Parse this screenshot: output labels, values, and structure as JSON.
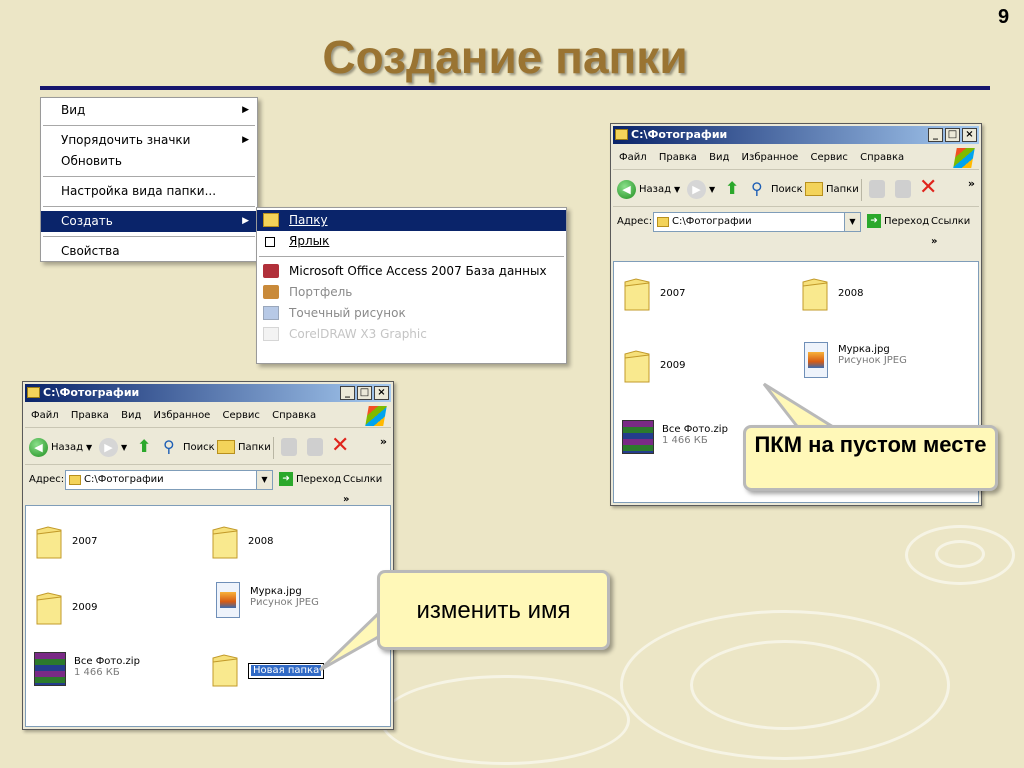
{
  "slide": {
    "number": "9",
    "title": "Создание папки"
  },
  "context_menu": {
    "items": [
      {
        "label": "Вид",
        "arrow": "▶"
      },
      {
        "label": "Упорядочить значки",
        "arrow": "▶"
      },
      {
        "label": "Обновить"
      },
      {
        "label": "Настройка вида папки..."
      },
      {
        "label": "Создать",
        "arrow": "▶",
        "selected": true
      },
      {
        "label": "Свойства"
      }
    ]
  },
  "submenu": {
    "items": [
      {
        "label": "Папку",
        "icon": "folder-icon",
        "selected": true
      },
      {
        "label": "Ярлык",
        "icon": "shortcut-icon"
      },
      {
        "label": "Microsoft Office Access 2007 База данных",
        "icon": "access-icon"
      },
      {
        "label": "Портфель",
        "icon": "briefcase-icon"
      },
      {
        "label": "Точечный рисунок",
        "icon": "bitmap-icon"
      },
      {
        "label": "CorelDRAW X3 Graphic",
        "icon": "corel-icon"
      }
    ]
  },
  "explorer": {
    "title": "C:\\Фотографии",
    "menu": [
      "Файл",
      "Правка",
      "Вид",
      "Избранное",
      "Сервис",
      "Справка"
    ],
    "toolbar": {
      "back": "Назад",
      "search": "Поиск",
      "folders": "Папки",
      "more": "»"
    },
    "address": {
      "label": "Адрес:",
      "value": "C:\\Фотографии",
      "go": "Переход",
      "links": "Ссылки",
      "more": "»"
    },
    "window_buttons": {
      "minimize": "_",
      "maximize": "□",
      "close": "×"
    },
    "items": {
      "f2007": "2007",
      "f2008": "2008",
      "f2009": "2009",
      "jpg_name": "Мурка.jpg",
      "jpg_type": "Рисунок JPEG",
      "zip_name": "Все Фото.zip",
      "zip_size": "1 466 КБ",
      "new_folder": "Новая папка"
    }
  },
  "callouts": {
    "right_click": "ПКМ на пустом месте",
    "rename": "изменить имя"
  },
  "colors": {
    "title": "#9a7432",
    "rule": "#16166e",
    "selection": "#0a246a",
    "callout": "#fff8b8"
  }
}
